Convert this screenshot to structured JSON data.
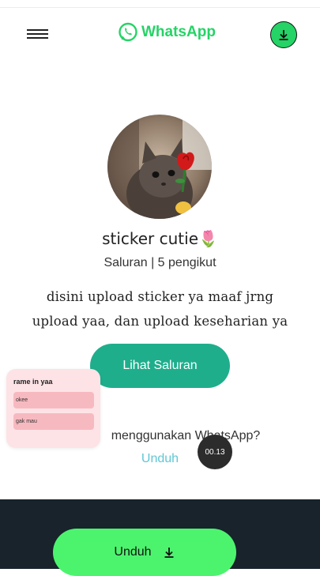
{
  "header": {
    "logo_text": "WhatsApp",
    "menu_icon": "hamburger-menu-icon",
    "download_icon": "download-icon"
  },
  "channel": {
    "name": "sticker cutie🌷",
    "subtitle": "Saluran | 5 pengikut",
    "description_line1": "disini upload sticker ya maaf jrng",
    "description_line2": "upload yaa, dan upload keseharian ya",
    "view_button": "Lihat Saluran"
  },
  "prompt": {
    "question": "menggunakan WhatsApp?",
    "download_link": "Unduh"
  },
  "poll_overlay": {
    "title": "rame in yaa",
    "options": [
      "okee",
      "gak mau"
    ]
  },
  "timer": "00.13",
  "footer": {
    "download_button": "Unduh"
  },
  "colors": {
    "brand_green": "#25d366",
    "teal_button": "#1fae8c",
    "footer_bg": "#18232b",
    "footer_button": "#4cf46e",
    "link": "#5fc7d6"
  }
}
